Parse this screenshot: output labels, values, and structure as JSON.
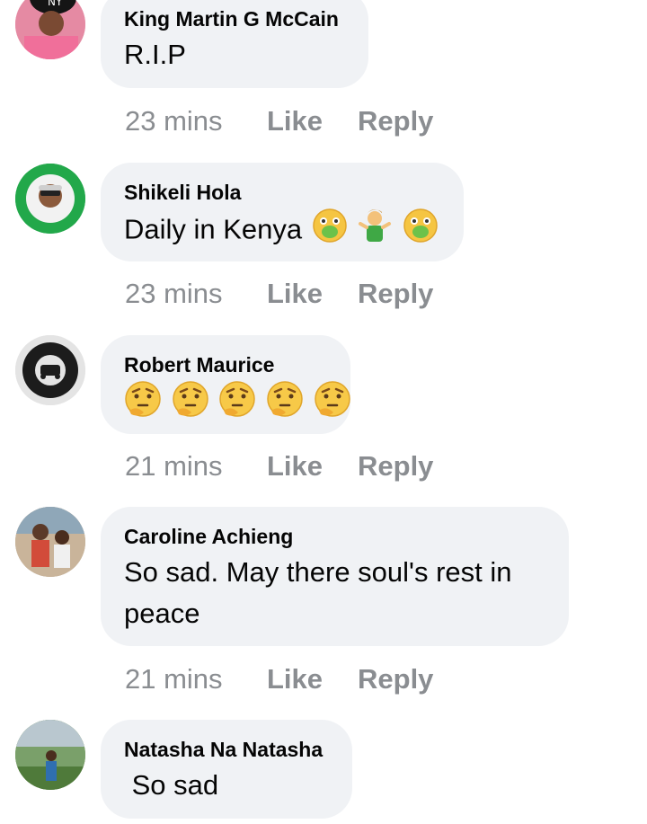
{
  "comments": [
    {
      "name": "King Martin G McCain",
      "text": "R.I.P",
      "time": "23 mins",
      "like": "Like",
      "reply": "Reply",
      "avatar_icon": "ny-cap-avatar"
    },
    {
      "name": "Shikeli Hola",
      "text": "Daily in Kenya",
      "time": "23 mins",
      "like": "Like",
      "reply": "Reply",
      "avatar_icon": "travel-tourism-badge-avatar",
      "emojis": [
        "nauseated-face",
        "man-shrugging",
        "nauseated-face"
      ]
    },
    {
      "name": "Robert Maurice",
      "text": "",
      "time": "21 mins",
      "like": "Like",
      "reply": "Reply",
      "avatar_icon": "dont-follow-me-sticker-avatar",
      "emojis": [
        "thinking-face",
        "thinking-face",
        "thinking-face",
        "thinking-face",
        "thinking-face"
      ]
    },
    {
      "name": "Caroline Achieng",
      "text_lines": [
        "So sad. May there soul's rest in",
        "peace"
      ],
      "time": "21 mins",
      "like": "Like",
      "reply": "Reply",
      "avatar_icon": "family-photo-avatar"
    },
    {
      "name": "Natasha Na Natasha",
      "text": " So sad",
      "avatar_icon": "outdoor-photo-avatar"
    }
  ],
  "colors": {
    "bubble": "#f0f2f5",
    "meta": "#8a8d91",
    "text": "#050505"
  }
}
